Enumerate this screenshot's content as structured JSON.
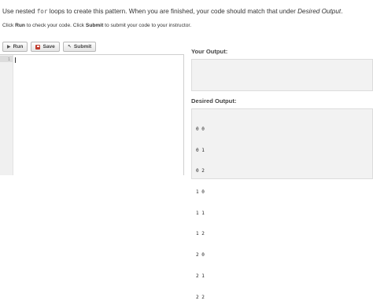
{
  "instructions": {
    "part1": "Use nested ",
    "code_word": "for",
    "part2": " loops to create this pattern.  When you are finished, your code should match that under ",
    "emph": "Desired Output",
    "part3": "."
  },
  "instructions2": {
    "p1": "Click ",
    "b1": "Run",
    "p2": " to check your code. Click ",
    "b2": "Submit",
    "p3": " to submit your code to your instructor."
  },
  "toolbar": {
    "run_label": "Run",
    "save_label": "Save",
    "submit_label": "Submit"
  },
  "editor": {
    "line_number": "1"
  },
  "your_output": {
    "label": "Your Output:"
  },
  "desired_output": {
    "label": "Desired Output:",
    "lines": [
      "0 0",
      "0 1",
      "0 2",
      "1 0",
      "1 1",
      "1 2",
      "2 0",
      "2 1",
      "2 2"
    ]
  }
}
